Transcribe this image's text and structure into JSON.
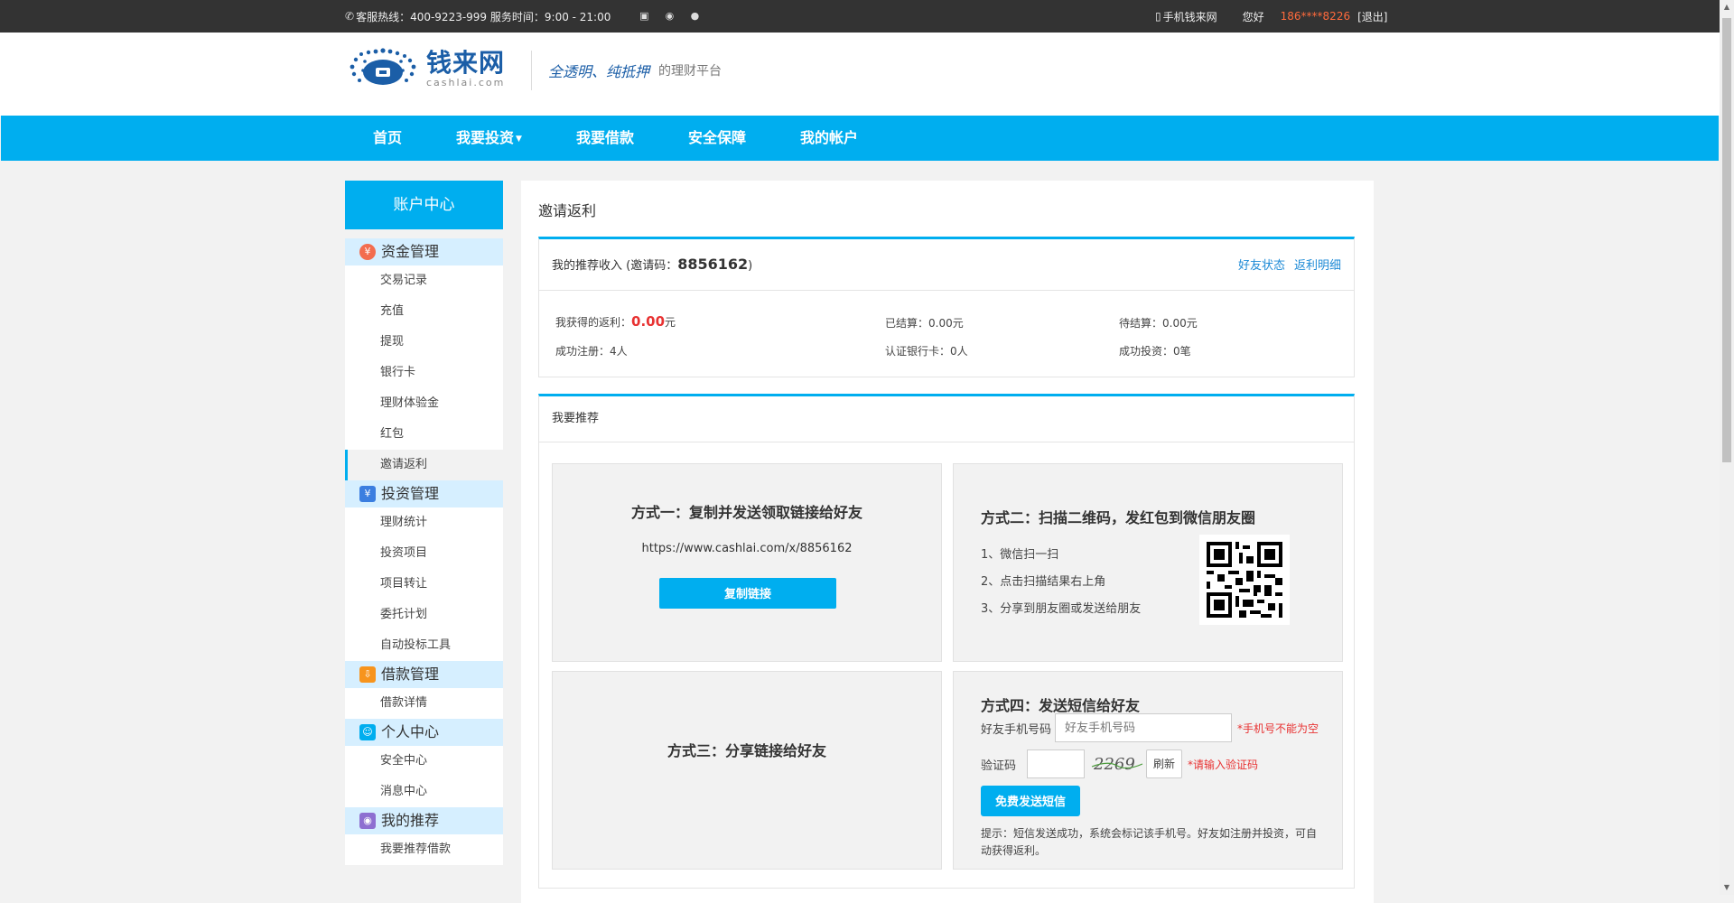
{
  "topbar": {
    "hotline": "客服热线：400-9223-999 服务时间：9:00 - 21:00",
    "icons": [
      "phone-icon",
      "mobile-icon",
      "weibo-icon",
      "wechat-icon"
    ],
    "mobile_site": "手机钱来网",
    "greeting": "您好",
    "phone": "186****8226",
    "logout": "[退出]"
  },
  "header": {
    "logo_cn": "钱来网",
    "logo_en": "cashlai.com",
    "slogan": "全透明、纯抵押",
    "slogan_suffix": "的理财平台"
  },
  "nav": [
    {
      "label": "首页"
    },
    {
      "label": "我要投资",
      "dropdown": true
    },
    {
      "label": "我要借款"
    },
    {
      "label": "安全保障"
    },
    {
      "label": "我的帐户"
    }
  ],
  "sidebar": {
    "title": "账户中心",
    "groups": [
      {
        "title": "资金管理",
        "icon": "money-bag-icon",
        "color": "#f36d4f",
        "items": [
          "交易记录",
          "充值",
          "提现",
          "银行卡",
          "理财体验金",
          "红包",
          "邀请返利"
        ]
      },
      {
        "title": "投资管理",
        "icon": "yen-icon",
        "color": "#3b7ee0",
        "items": [
          "理财统计",
          "投资项目",
          "项目转让",
          "委托计划",
          "自动投标工具"
        ]
      },
      {
        "title": "借款管理",
        "icon": "download-icon",
        "color": "#f7941d",
        "items": [
          "借款详情"
        ]
      },
      {
        "title": "个人中心",
        "icon": "user-icon",
        "color": "#00aeef",
        "items": [
          "安全中心",
          "消息中心"
        ]
      },
      {
        "title": "我的推荐",
        "icon": "users-icon",
        "color": "#8e6fd1",
        "items": [
          "我要推荐借款"
        ]
      }
    ],
    "active_item": "邀请返利"
  },
  "main": {
    "title": "邀请返利",
    "income": {
      "label": "我的推荐收入 (邀请码：",
      "code": "8856162",
      "label_end": ")",
      "links": [
        "好友状态",
        "返利明细"
      ],
      "rebate_label": "我获得的返利：",
      "rebate_value": "0.00",
      "rebate_unit": "元",
      "settled": "已结算：0.00元",
      "pending": "待结算：0.00元",
      "registered": "成功注册：4人",
      "bank_verified": "认证银行卡：0人",
      "invested": "成功投资：0笔"
    },
    "recommend": {
      "title": "我要推荐",
      "way1": {
        "title": "方式一：复制并发送领取链接给好友",
        "url": "https://www.cashlai.com/x/8856162",
        "button": "复制链接"
      },
      "way2": {
        "title": "方式二：扫描二维码，发红包到微信朋友圈",
        "steps": [
          "1、微信扫一扫",
          "2、点击扫描结果右上角",
          "3、分享到朋友圈或发送给朋友"
        ]
      },
      "way3": {
        "title": "方式三：分享链接给好友"
      },
      "way4": {
        "title": "方式四：发送短信给好友",
        "phone_label": "好友手机号码",
        "phone_placeholder": "好友手机号码",
        "phone_error": "*手机号不能为空",
        "captcha_label": "验证码",
        "captcha_text": "2269",
        "refresh": "刷新",
        "captcha_error": "*请输入验证码",
        "button": "免费发送短信",
        "tip": "提示：短信发送成功，系统会标记该手机号。好友如注册并投资，可自动获得返利。"
      }
    }
  }
}
